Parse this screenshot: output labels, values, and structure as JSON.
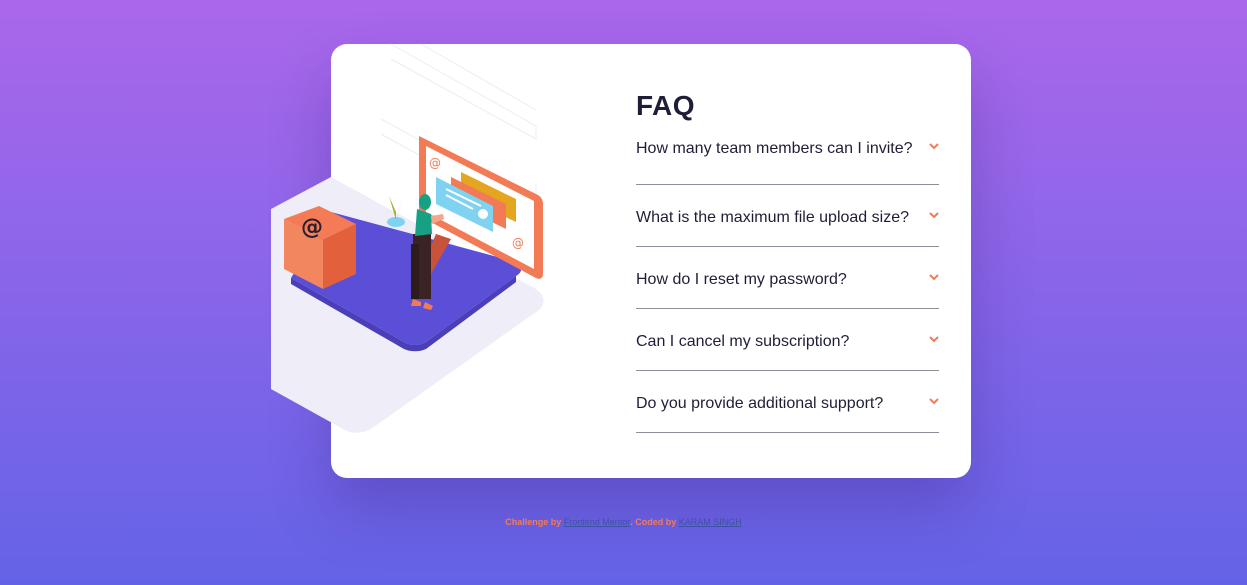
{
  "faq": {
    "title": "FAQ",
    "questions": [
      "How many team members can I invite?",
      "What is the maximum file upload size?",
      "How do I reset my password?",
      "Can I cancel my subscription?",
      "Do you provide additional support?"
    ]
  },
  "footer": {
    "prefix": "Challenge by ",
    "challenge_link": "Frontend Mentor",
    "middle": ". Coded by ",
    "author_link": "KARAM SINGH"
  },
  "colors": {
    "bg_top": "#AB67EB",
    "bg_bottom": "#6463E7",
    "title": "#1E1F36",
    "chevron": "#F47B56",
    "divider": "#8f8f9a",
    "footer_text": "#F47B56",
    "footer_link": "#3E52A3"
  },
  "icons": {
    "chevron": "chevron-down-icon",
    "illustration": "woman-online-illustration",
    "box": "box-illustration"
  }
}
